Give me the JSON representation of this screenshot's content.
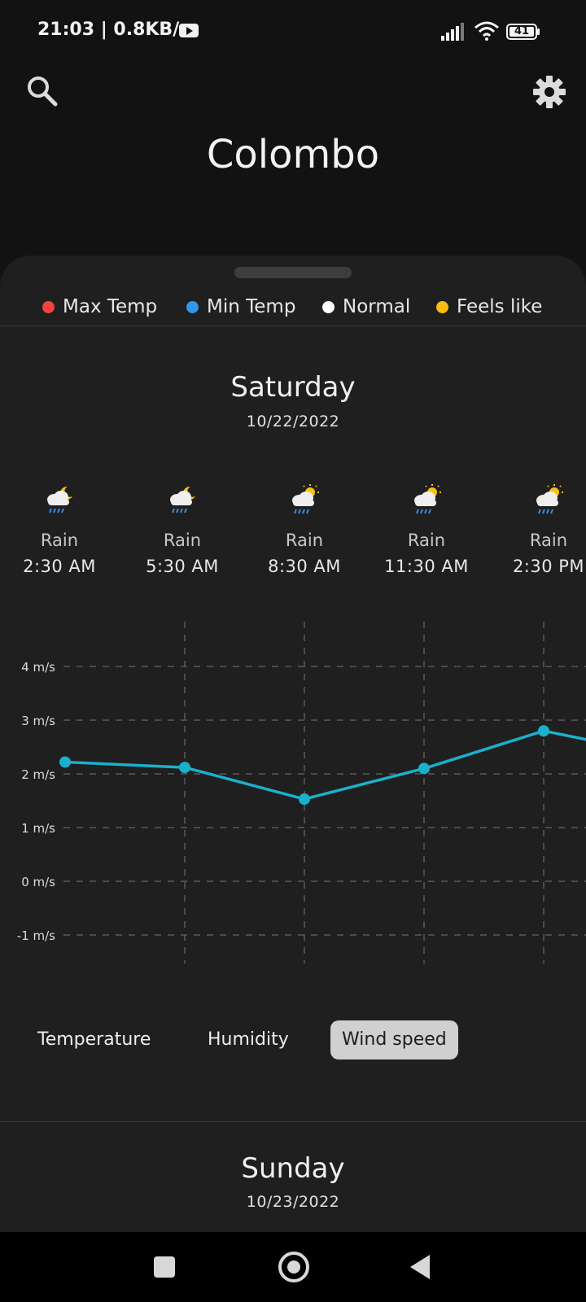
{
  "status_bar": {
    "time": "21:03",
    "speed": "0.8KB/s",
    "battery": "41"
  },
  "header": {
    "city": "Colombo"
  },
  "legend": [
    {
      "label": "Max Temp",
      "color": "#f4433f"
    },
    {
      "label": "Min Temp",
      "color": "#2f98ee"
    },
    {
      "label": "Normal",
      "color": "#ffffff"
    },
    {
      "label": "Feels like",
      "color": "#fbbc12"
    }
  ],
  "days": [
    {
      "name": "Saturday",
      "date": "10/22/2022",
      "forecast": [
        {
          "condition": "Rain",
          "time": "2:30 AM",
          "icon": "night-rain-icon"
        },
        {
          "condition": "Rain",
          "time": "5:30 AM",
          "icon": "night-rain-icon"
        },
        {
          "condition": "Rain",
          "time": "8:30 AM",
          "icon": "day-rain-icon"
        },
        {
          "condition": "Rain",
          "time": "11:30 AM",
          "icon": "day-rain-icon"
        },
        {
          "condition": "Rain",
          "time": "2:30 PM",
          "icon": "day-rain-icon"
        }
      ]
    },
    {
      "name": "Sunday",
      "date": "10/23/2022"
    }
  ],
  "chart_data": {
    "type": "line",
    "title": "",
    "xlabel": "",
    "ylabel": "",
    "y_ticks": [
      "4 m/s",
      "3 m/s",
      "2 m/s",
      "1 m/s",
      "0 m/s",
      "-1 m/s"
    ],
    "ylim": [
      -1,
      4
    ],
    "grid": true,
    "series": [
      {
        "values": [
          2.22,
          2.12,
          1.53,
          2.1,
          2.8,
          2.35
        ],
        "color": "#1ab0cc"
      }
    ]
  },
  "tabs": [
    {
      "label": "Temperature",
      "active": false
    },
    {
      "label": "Humidity",
      "active": false
    },
    {
      "label": "Wind speed",
      "active": true
    }
  ]
}
